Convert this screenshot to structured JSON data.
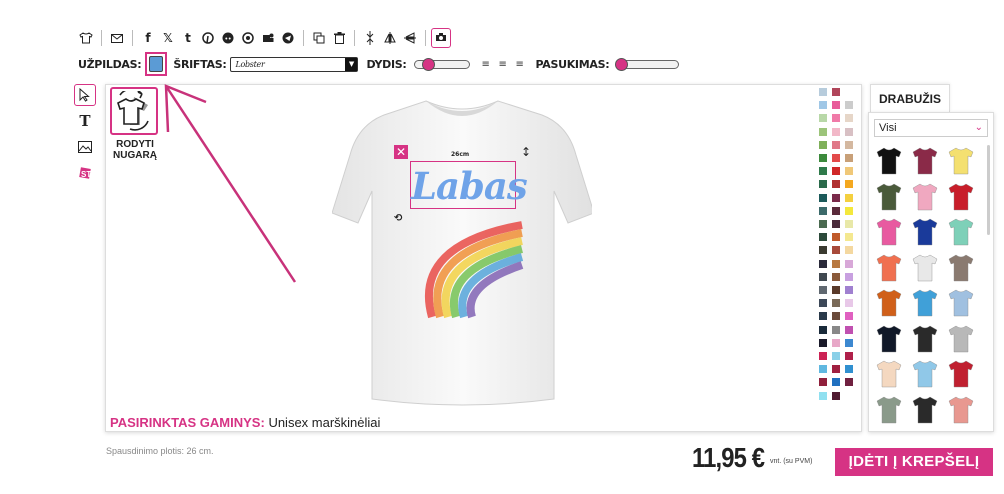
{
  "toolbar": {
    "icons": [
      "tshirt-icon",
      "email-icon",
      "facebook-icon",
      "x-twitter-icon",
      "tumblr-icon",
      "pinterest-icon",
      "reddit-icon",
      "whatsapp-icon",
      "teams-icon",
      "telegram-icon",
      "copy-icon",
      "trash-icon",
      "align-center-icon",
      "flip-vertical-icon",
      "flip-horizontal-icon",
      "preview-icon"
    ],
    "glyphs": {
      "facebook": "f",
      "x": "𝕏",
      "tumblr": "t"
    }
  },
  "options": {
    "fill_label": "UŽPILDAS:",
    "fill_color": "#5b9bd5",
    "font_label": "ŠRIFTAS:",
    "font_value": "Lobster",
    "size_label": "DYDIS:",
    "size_value": 0.15,
    "rotation_label": "PASUKIMAS:",
    "rotation_value": 0.0
  },
  "canvas": {
    "show_back_label": "RODYTI NUGARĄ",
    "design_text": "Labas",
    "design_text_color": "#6fa3e8",
    "width_label": "26cm",
    "product_key": "PASIRINKTAS GAMINYS:",
    "product_value": "Unisex marškinėliai"
  },
  "colors": [
    "#b7ccdc",
    "#b0455a",
    "#ffffff",
    "#9fc7e6",
    "#e85c9a",
    "#cccccc",
    "#b8d8a8",
    "#f07aa8",
    "#e6d6c8",
    "#9cc47a",
    "#f2b8c8",
    "#d8c0c4",
    "#7fb05a",
    "#e07888",
    "#d4b8a0",
    "#3c8a3c",
    "#e34a4a",
    "#c8a078",
    "#2f7a4a",
    "#d02828",
    "#f0c878",
    "#2a6a4a",
    "#b03030",
    "#f4a820",
    "#1c5a5a",
    "#7a2a4a",
    "#f4d040",
    "#3c6a6a",
    "#5a2a3a",
    "#f4e83c",
    "#4a6a50",
    "#4a2a3a",
    "#e8e8a8",
    "#2c4a3a",
    "#c05a2a",
    "#f4e890",
    "#3a3a30",
    "#a84a3a",
    "#f4d8a0",
    "#2a2a3a",
    "#b87840",
    "#d8a8d8",
    "#404850",
    "#8a5a3a",
    "#c8a0e0",
    "#606870",
    "#5a3a2a",
    "#a080d0",
    "#3c4858",
    "#7a6a58",
    "#e8c8e8",
    "#2a3a4a",
    "#6a4a3a",
    "#e060c0",
    "#1a2a3a",
    "#888888",
    "#c050b0",
    "#1a1a2a",
    "#e8a8c8",
    "#3c88d0",
    "#cc2255",
    "#8ad0e8",
    "#b0204a",
    "#60b8e0",
    "#a02040",
    "#3090d0",
    "#90203c",
    "#2070c0",
    "#702040",
    "#90e0f0",
    "#501a30"
  ],
  "drabuzis": {
    "tab": "DRABUŽIS",
    "filter": "Visi",
    "items": [
      {
        "color": "#111111"
      },
      {
        "color": "#8a2a48"
      },
      {
        "color": "#f4e070"
      },
      {
        "color": "#4a5a3a"
      },
      {
        "color": "#f0a8c0"
      },
      {
        "color": "#c81e2a"
      },
      {
        "color": "#e85aa0"
      },
      {
        "color": "#1a3a9a"
      },
      {
        "color": "#7ed0b8"
      },
      {
        "color": "#f07050"
      },
      {
        "color": "#e8e8e8"
      },
      {
        "color": "#8a7a70"
      },
      {
        "color": "#d0601a"
      },
      {
        "color": "#40a0d8"
      },
      {
        "color": "#a0c0e0"
      },
      {
        "color": "#101828"
      },
      {
        "color": "#2a2a2a"
      },
      {
        "color": "#b8b8b8"
      },
      {
        "color": "#f4d8c0"
      },
      {
        "color": "#90c8e8"
      },
      {
        "color": "#c02030"
      },
      {
        "color": "#8a9a8a"
      },
      {
        "color": "#2a2a2a"
      },
      {
        "color": "#e89890"
      }
    ]
  },
  "footer": {
    "print_width": "Spausdinimo plotis: 26 cm.",
    "price": "11,95 €",
    "price_sub": "vnt. (su PVM)",
    "cart": "ĮDĖTI Į KREPŠELĮ"
  }
}
